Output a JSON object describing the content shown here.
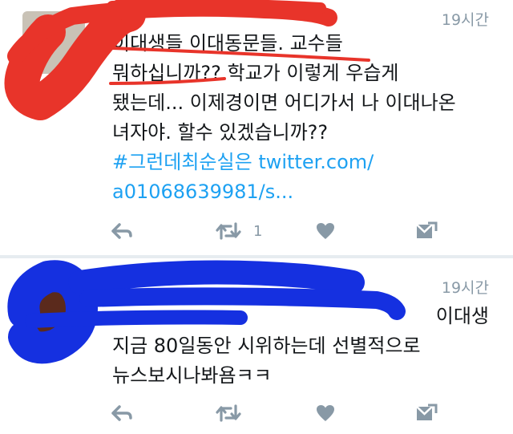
{
  "tweets": [
    {
      "time": "19시간",
      "text_lines": [
        "이대생들 이대동문들. 교수들",
        "뭐하십니까?? 학교가 이렇게 우습게",
        "됐는데... 이제경이면 어디가서 나 이대나온",
        "녀자야. 할수 있겠습니까??"
      ],
      "hashtag": "#그런데최순실은",
      "link_part1": "twitter.com/",
      "link_part2": "a01068639981/s...",
      "retweet_count": "1"
    },
    {
      "time": "19시간",
      "mention_tail": "이대생",
      "text_lines": [
        "지금 80일동안 시위하는데 선별적으로",
        "뉴스보시나봐욤ㅋㅋ"
      ]
    }
  ],
  "icons": [
    "reply-icon",
    "retweet-icon",
    "like-icon",
    "dm-icon"
  ],
  "colors": {
    "link": "#1da1f2",
    "muted": "#8899a6",
    "red_redaction": "#e8342a",
    "blue_redaction": "#1530e0"
  }
}
